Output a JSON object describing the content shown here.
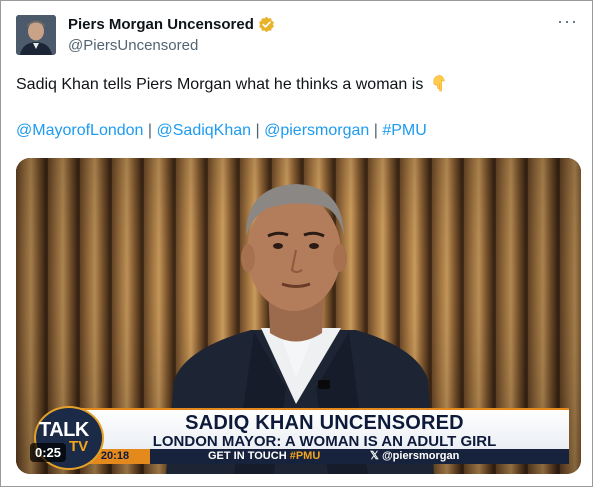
{
  "author": {
    "name": "Piers Morgan Uncensored",
    "handle": "@PiersUncensored",
    "verified_color": "#e8b22a"
  },
  "more_icon": "···",
  "tweet": {
    "text": "Sadiq Khan tells Piers Morgan what he thinks a woman is",
    "emoji": "pointing-down-hand",
    "tags": [
      "@MayorofLondon",
      "@SadiqKhan",
      "@piersmorgan",
      "#PMU"
    ],
    "separator": "|"
  },
  "video": {
    "timestamp": "0:25",
    "logo_talk": "TALK",
    "logo_tv": "TV",
    "headline": "SADIQ KHAN UNCENSORED",
    "subhead": "LONDON MAYOR: A WOMAN IS AN ADULT GIRL",
    "clock": "20:18",
    "ticker_prefix": "GET IN TOUCH",
    "ticker_tag": "#PMU",
    "ticker_handle": "@piersmorgan"
  },
  "colors": {
    "link": "#1d9bf0",
    "text": "#0f1419",
    "secondary": "#536471",
    "talk_orange": "#e48a1c",
    "talk_navy": "#17233d"
  }
}
